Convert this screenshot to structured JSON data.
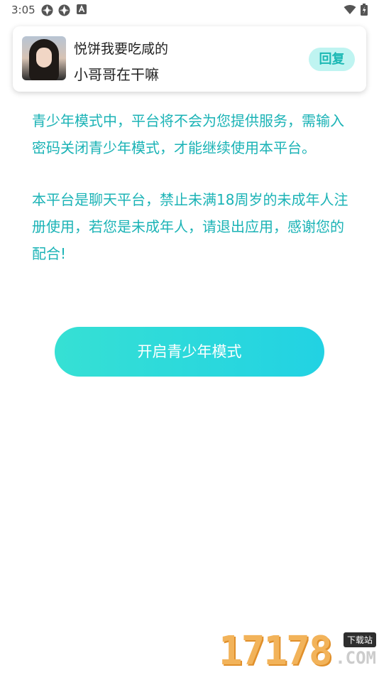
{
  "status_bar": {
    "time": "3:05",
    "icons_left": [
      "pinwheel-icon",
      "pinwheel-icon",
      "app-a-icon"
    ],
    "icons_right": [
      "wifi-icon",
      "battery-icon"
    ]
  },
  "notification": {
    "sender": "悦饼我要吃咸的",
    "message": "小哥哥在干嘛",
    "reply_label": "回复"
  },
  "content": {
    "paragraph1": "青少年模式中，平台将不会为您提供服务，需输入密码关闭青少年模式，才能继续使用本平台。",
    "paragraph2": "本平台是聊天平台，禁止未满18周岁的未成年人注册使用，若您是未成年人，请退出应用，感谢您的配合!"
  },
  "actions": {
    "enable_teen_mode": "开启青少年模式"
  },
  "watermark": {
    "number": "17178",
    "badge": "下载站",
    "domain": ".COM"
  },
  "colors": {
    "accent_text": "#1bb3b6",
    "button_gradient_start": "#36e0d4",
    "button_gradient_end": "#22d2e3",
    "reply_bg": "#bff4f1"
  }
}
